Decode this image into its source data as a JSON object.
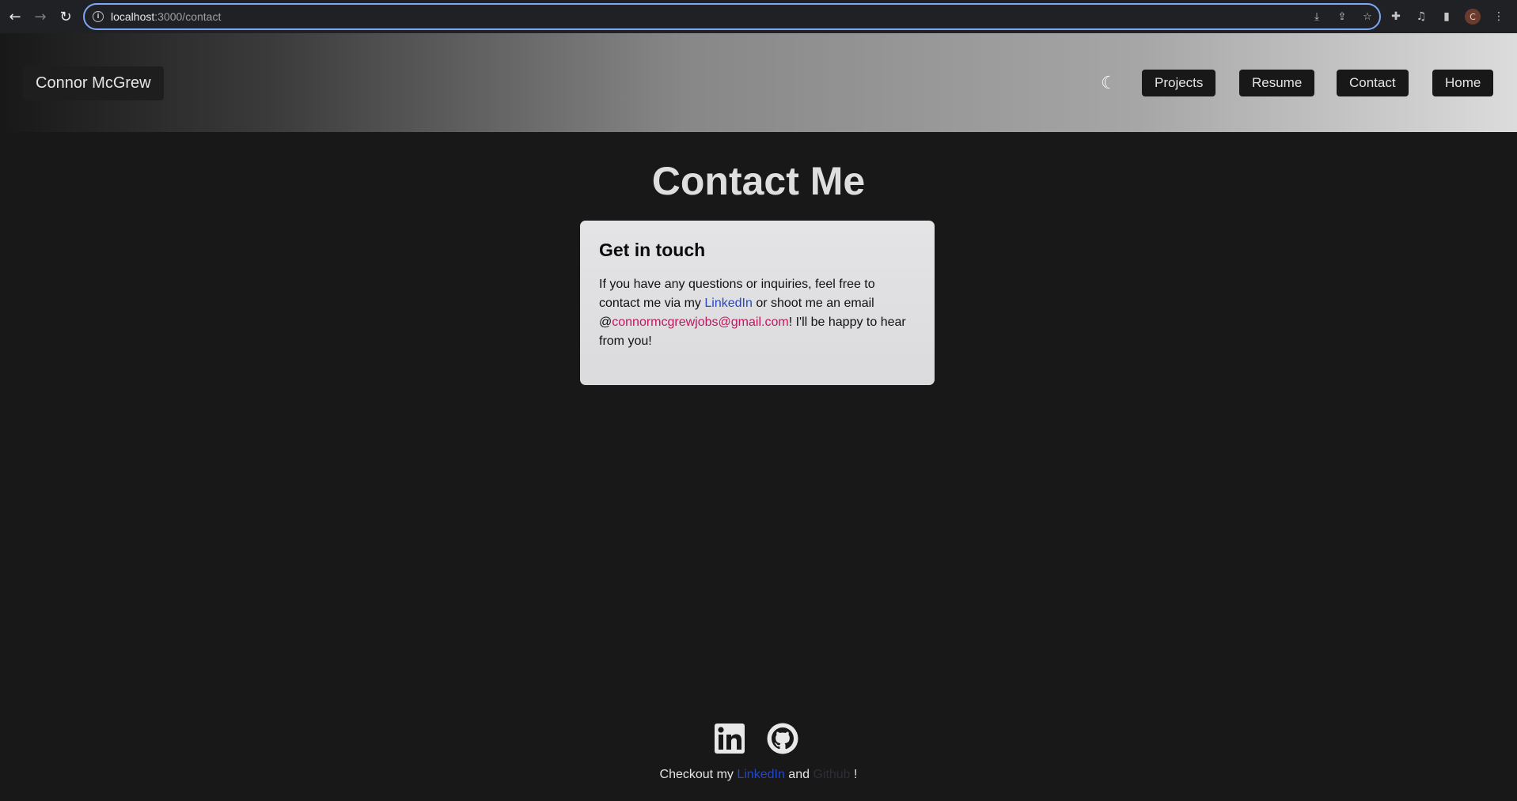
{
  "browser": {
    "url_host": "localhost",
    "url_path": ":3000/contact",
    "profile_initial": "C"
  },
  "header": {
    "brand": "Connor McGrew",
    "nav": [
      "Projects",
      "Resume",
      "Contact",
      "Home"
    ]
  },
  "main": {
    "title": "Contact Me",
    "card": {
      "heading": "Get in touch",
      "text_1": "If you have any questions or inquiries, feel free to contact me via my ",
      "linkedin": "LinkedIn",
      "text_2": " or shoot me an email @",
      "email": "connormcgrewjobs@gmail.com",
      "text_3": "! I'll be happy to hear from you!"
    }
  },
  "footer": {
    "text_1": "Checkout my ",
    "linkedin": "LinkedIn",
    "text_2": " and ",
    "github": "Github",
    "text_3": " !"
  },
  "colors": {
    "page_bg": "#181818",
    "link_blue": "#2447c9",
    "email_pink": "#c0175f"
  }
}
